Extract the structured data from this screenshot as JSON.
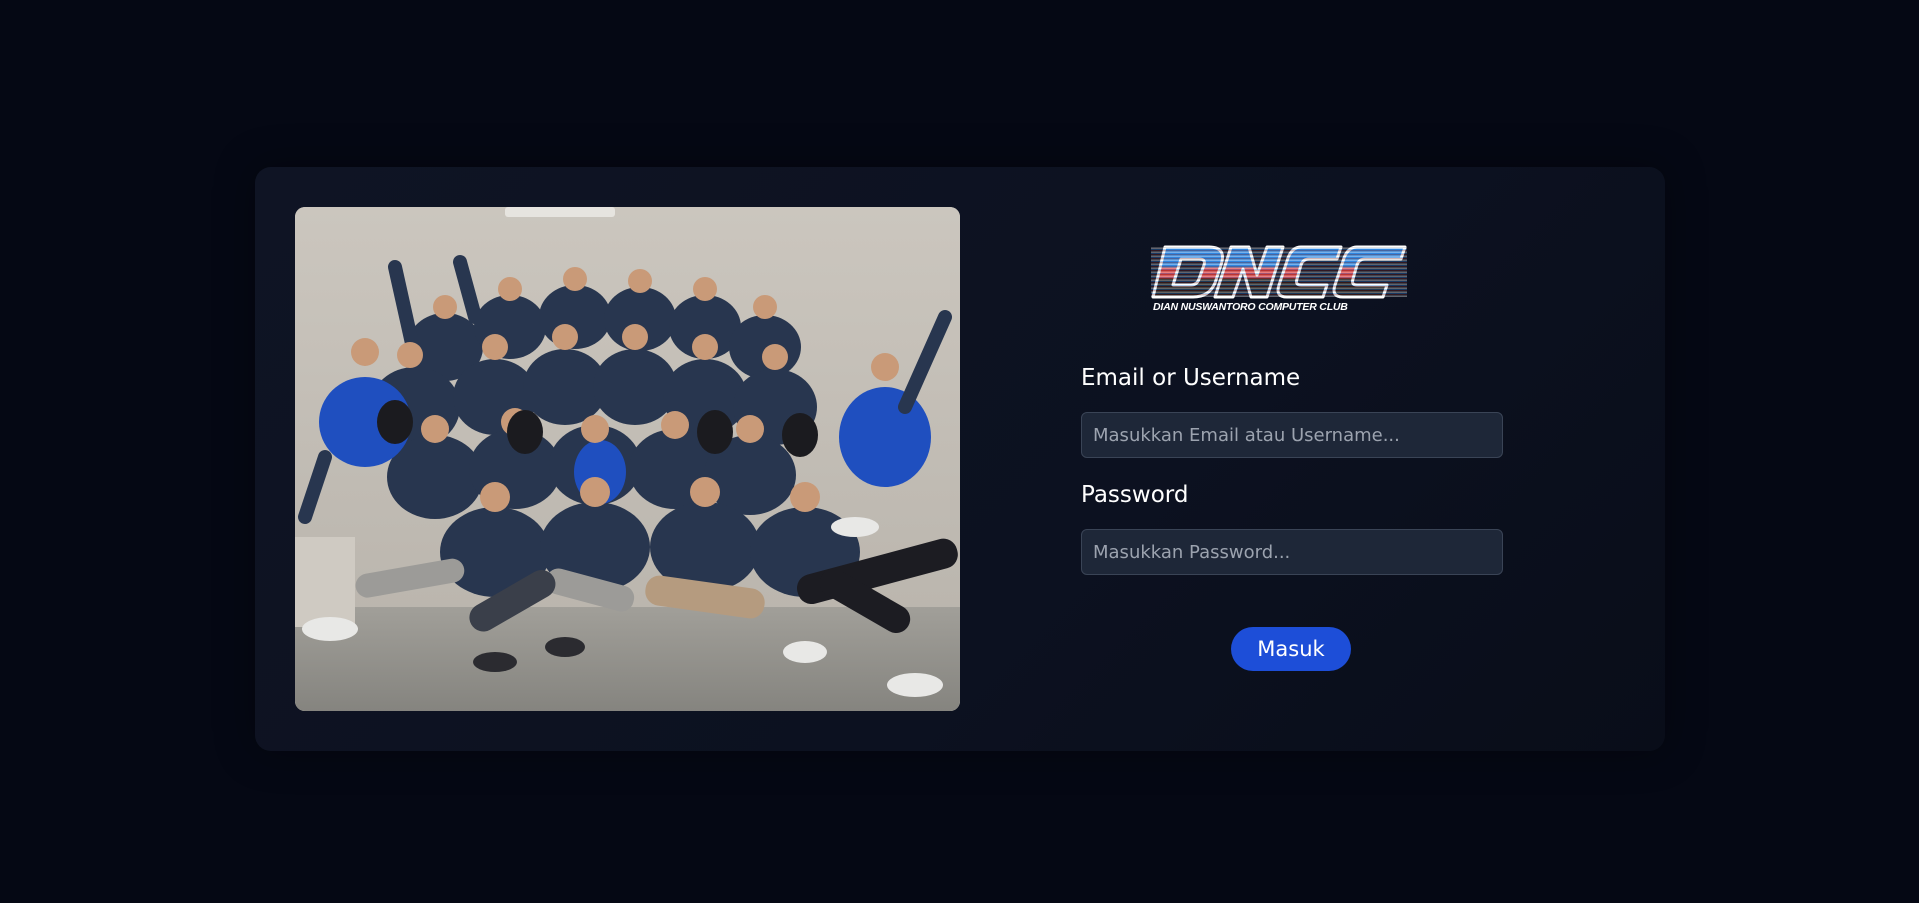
{
  "brand": {
    "logo_text": "DIAN NUSWANTORO COMPUTER CLUB",
    "logo_mark": "DNCC",
    "colors": {
      "logo_blue": "#2f86e0",
      "logo_red": "#e03a3a",
      "logo_dark": "#111111"
    }
  },
  "login": {
    "email_label": "Email or Username",
    "email_placeholder": "Masukkan Email atau Username...",
    "email_value": "",
    "password_label": "Password",
    "password_placeholder": "Masukkan Password...",
    "password_value": "",
    "submit_label": "Masuk"
  },
  "colors": {
    "page_bg": "#050814",
    "card_bg": "#0f1424",
    "input_bg": "#1e2738",
    "button_bg": "#1d4ed8"
  },
  "icons": {
    "hero": "group-photo"
  }
}
